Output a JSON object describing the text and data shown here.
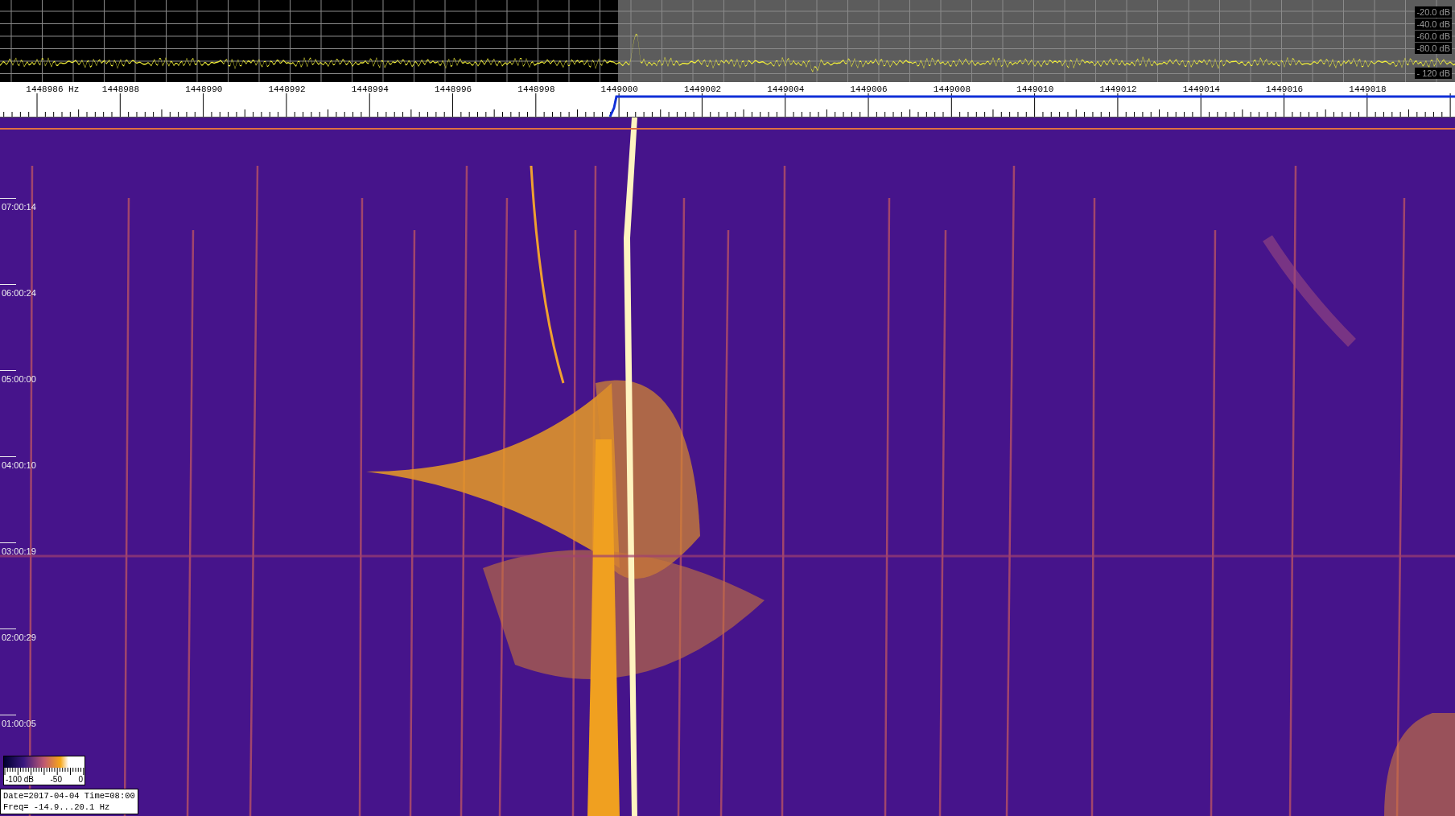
{
  "spectrum": {
    "db_labels": [
      "-20.0 dB",
      "-40.0 dB",
      "-60.0 dB",
      "-80.0 dB",
      "- 120 dB"
    ]
  },
  "frequency_axis": {
    "labels": [
      "1448986 Hz",
      "1448988",
      "1448990",
      "1448992",
      "1448994",
      "1448996",
      "1448998",
      "1449000",
      "1449002",
      "1449004",
      "1449006",
      "1449008",
      "1449010",
      "1449012",
      "1449014",
      "1449016",
      "1449018"
    ]
  },
  "time_axis": {
    "labels": [
      "07:00:14",
      "06:00:24",
      "05:00:00",
      "04:00:10",
      "03:00:19",
      "02:00:29",
      "01:00:05"
    ]
  },
  "color_legend": {
    "labels": [
      "-100 dB",
      "-50",
      "0"
    ]
  },
  "info_box": {
    "lines": [
      "Date=2017-04-04 Time=08:00",
      "Freq= -14.9...20.1 Hz"
    ]
  }
}
